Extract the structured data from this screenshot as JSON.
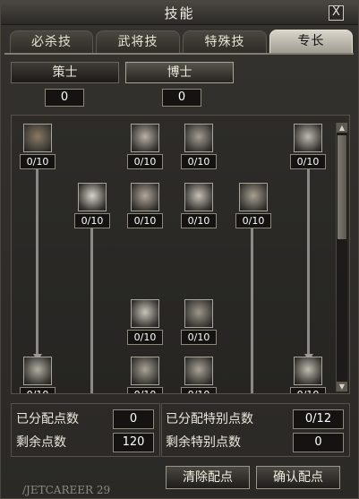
{
  "window": {
    "title": "技能",
    "close_label": "X"
  },
  "tabs": [
    {
      "label": "必杀技",
      "active": false
    },
    {
      "label": "武将技",
      "active": false
    },
    {
      "label": "特殊技",
      "active": false
    },
    {
      "label": "专长",
      "active": true
    }
  ],
  "subtabs": [
    {
      "label": "策士",
      "points": "0",
      "active": false
    },
    {
      "label": "博士",
      "points": "0",
      "active": true
    }
  ],
  "skills": [
    {
      "icon": "barrel-icon",
      "level": "0/10",
      "color": "#8a7a62"
    },
    {
      "icon": "aura-body-icon",
      "level": "0/10",
      "color": "#b8b2a6"
    },
    {
      "icon": "muscle-body-icon",
      "level": "0/10",
      "color": "#a39e92"
    },
    {
      "icon": "slash-lines-icon",
      "level": "0/10",
      "color": "#bdbab2"
    },
    {
      "icon": "sparkle-burst-icon",
      "level": "0/10",
      "color": "#d7d4ca"
    },
    {
      "icon": "fist-icon",
      "level": "0/10",
      "color": "#b2a89a"
    },
    {
      "icon": "strike-pose-icon",
      "level": "0/10",
      "color": "#c6c1b6"
    },
    {
      "icon": "herb-leaf-icon",
      "level": "0/10",
      "color": "#a7a18f"
    },
    {
      "icon": "glow-figure-icon",
      "level": "0/10",
      "color": "#c9c5bb"
    },
    {
      "icon": "brain-head-icon",
      "level": "0/10",
      "color": "#9c978a"
    },
    {
      "icon": "flame-icon",
      "level": "0/10",
      "color": "#b3aea3"
    },
    {
      "icon": "rune-circle-icon",
      "level": "0/10",
      "color": "#a9a397"
    },
    {
      "icon": "rune-circle-2-icon",
      "level": "0/10",
      "color": "#aaa498"
    },
    {
      "icon": "claw-slash-icon",
      "level": "0/10",
      "color": "#c0bcb2"
    }
  ],
  "stats": {
    "allocated_label": "已分配点数",
    "allocated_value": "0",
    "remaining_label": "剩余点数",
    "remaining_value": "120",
    "special_allocated_label": "已分配特别点数",
    "special_allocated_value": "0/12",
    "special_remaining_label": "剩余特别点数",
    "special_remaining_value": "0"
  },
  "buttons": {
    "clear_label": "清除配点",
    "confirm_label": "确认配点"
  },
  "watermark": "/JETCAREER 29"
}
